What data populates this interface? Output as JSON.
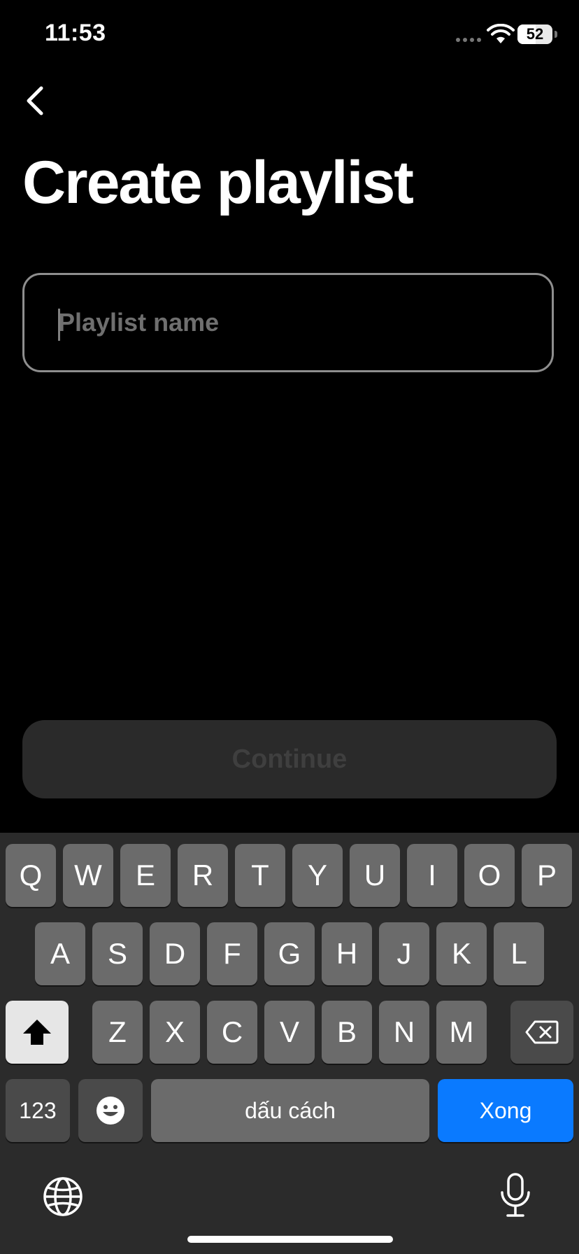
{
  "status_bar": {
    "time": "11:53",
    "battery": "52",
    "battery_level_percent": 52
  },
  "header": {
    "back_icon": "chevron-left-icon",
    "title": "Create playlist"
  },
  "form": {
    "playlist_name_value": "",
    "playlist_name_placeholder": "Playlist name",
    "continue_label": "Continue"
  },
  "keyboard": {
    "row1": [
      "Q",
      "W",
      "E",
      "R",
      "T",
      "Y",
      "U",
      "I",
      "O",
      "P"
    ],
    "row2": [
      "A",
      "S",
      "D",
      "F",
      "G",
      "H",
      "J",
      "K",
      "L"
    ],
    "row3": [
      "Z",
      "X",
      "C",
      "V",
      "B",
      "N",
      "M"
    ],
    "numbers_label": "123",
    "space_label": "dấu cách",
    "done_label": "Xong",
    "shift_icon": "shift-icon",
    "delete_icon": "backspace-icon",
    "emoji_icon": "emoji-icon",
    "globe_icon": "globe-icon",
    "mic_icon": "microphone-icon"
  },
  "colors": {
    "background": "#000000",
    "done_key": "#0a7aff",
    "keyboard": "#2b2b2b"
  }
}
